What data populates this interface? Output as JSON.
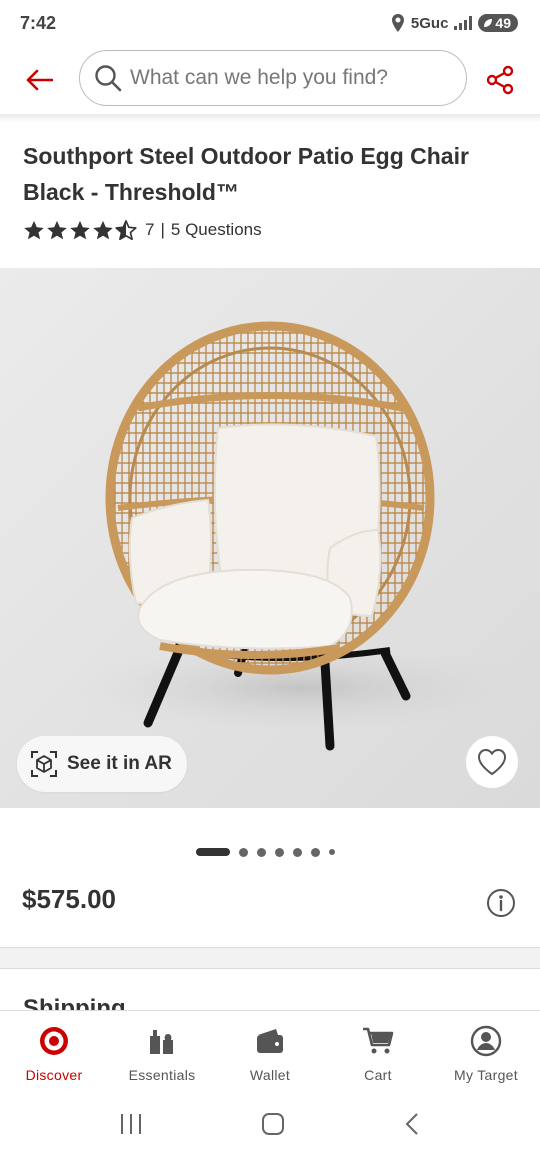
{
  "status_bar": {
    "time": "7:42",
    "network": "5Guc",
    "battery": "49"
  },
  "search": {
    "placeholder": "What can we help you find?"
  },
  "product": {
    "title": "Southport Steel Outdoor Patio Egg Chair Black - Threshold™",
    "rating": 4.5,
    "rating_max": 5,
    "review_count": "7",
    "separator": "|",
    "questions": "5 Questions",
    "price": "$575.00",
    "image_count": 7,
    "active_image": 0
  },
  "ar_button": {
    "label": "See it in AR"
  },
  "section": {
    "shipping_heading": "Shipping"
  },
  "bottom_nav": [
    {
      "label": "Discover",
      "icon": "target-bullseye-icon",
      "active": true
    },
    {
      "label": "Essentials",
      "icon": "essentials-bottles-icon",
      "active": false
    },
    {
      "label": "Wallet",
      "icon": "wallet-icon",
      "active": false
    },
    {
      "label": "Cart",
      "icon": "cart-icon",
      "active": false
    },
    {
      "label": "My Target",
      "icon": "account-icon",
      "active": false
    }
  ],
  "colors": {
    "brand_red": "#cc0000",
    "text": "#333333"
  }
}
